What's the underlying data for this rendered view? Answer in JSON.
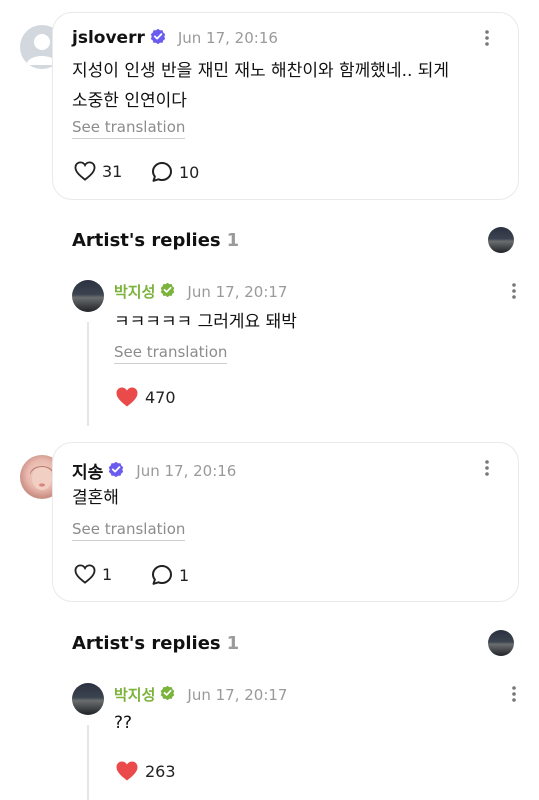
{
  "comments": [
    {
      "username": "jsloverr",
      "timestamp": "Jun 17, 20:16",
      "text_line1": "지성이 인생 반을 재민 재노 해찬이와 함께했네.. 되게",
      "text_line2": "소중한 인연이다",
      "translate": "See translation",
      "likes": "31",
      "replies": "10",
      "artist_replies_title": "Artist's replies",
      "artist_replies_count": "1",
      "artist_reply": {
        "name": "박지성",
        "timestamp": "Jun 17, 20:17",
        "text": "ㅋㅋㅋㅋㅋ 그러게요 돼박",
        "translate": "See translation",
        "likes": "470"
      }
    },
    {
      "username": "지송",
      "timestamp": "Jun 17, 20:16",
      "text": "결혼해",
      "translate": "See translation",
      "likes": "1",
      "replies": "1",
      "artist_replies_title": "Artist's replies",
      "artist_replies_count": "1",
      "artist_reply": {
        "name": "박지성",
        "timestamp": "Jun 17, 20:17",
        "text": "??",
        "likes": "263"
      }
    }
  ],
  "icons": {
    "verified_purple": "#6b5cf0",
    "verified_green": "#7bb33d",
    "liked_red": "#ea4a4a"
  }
}
